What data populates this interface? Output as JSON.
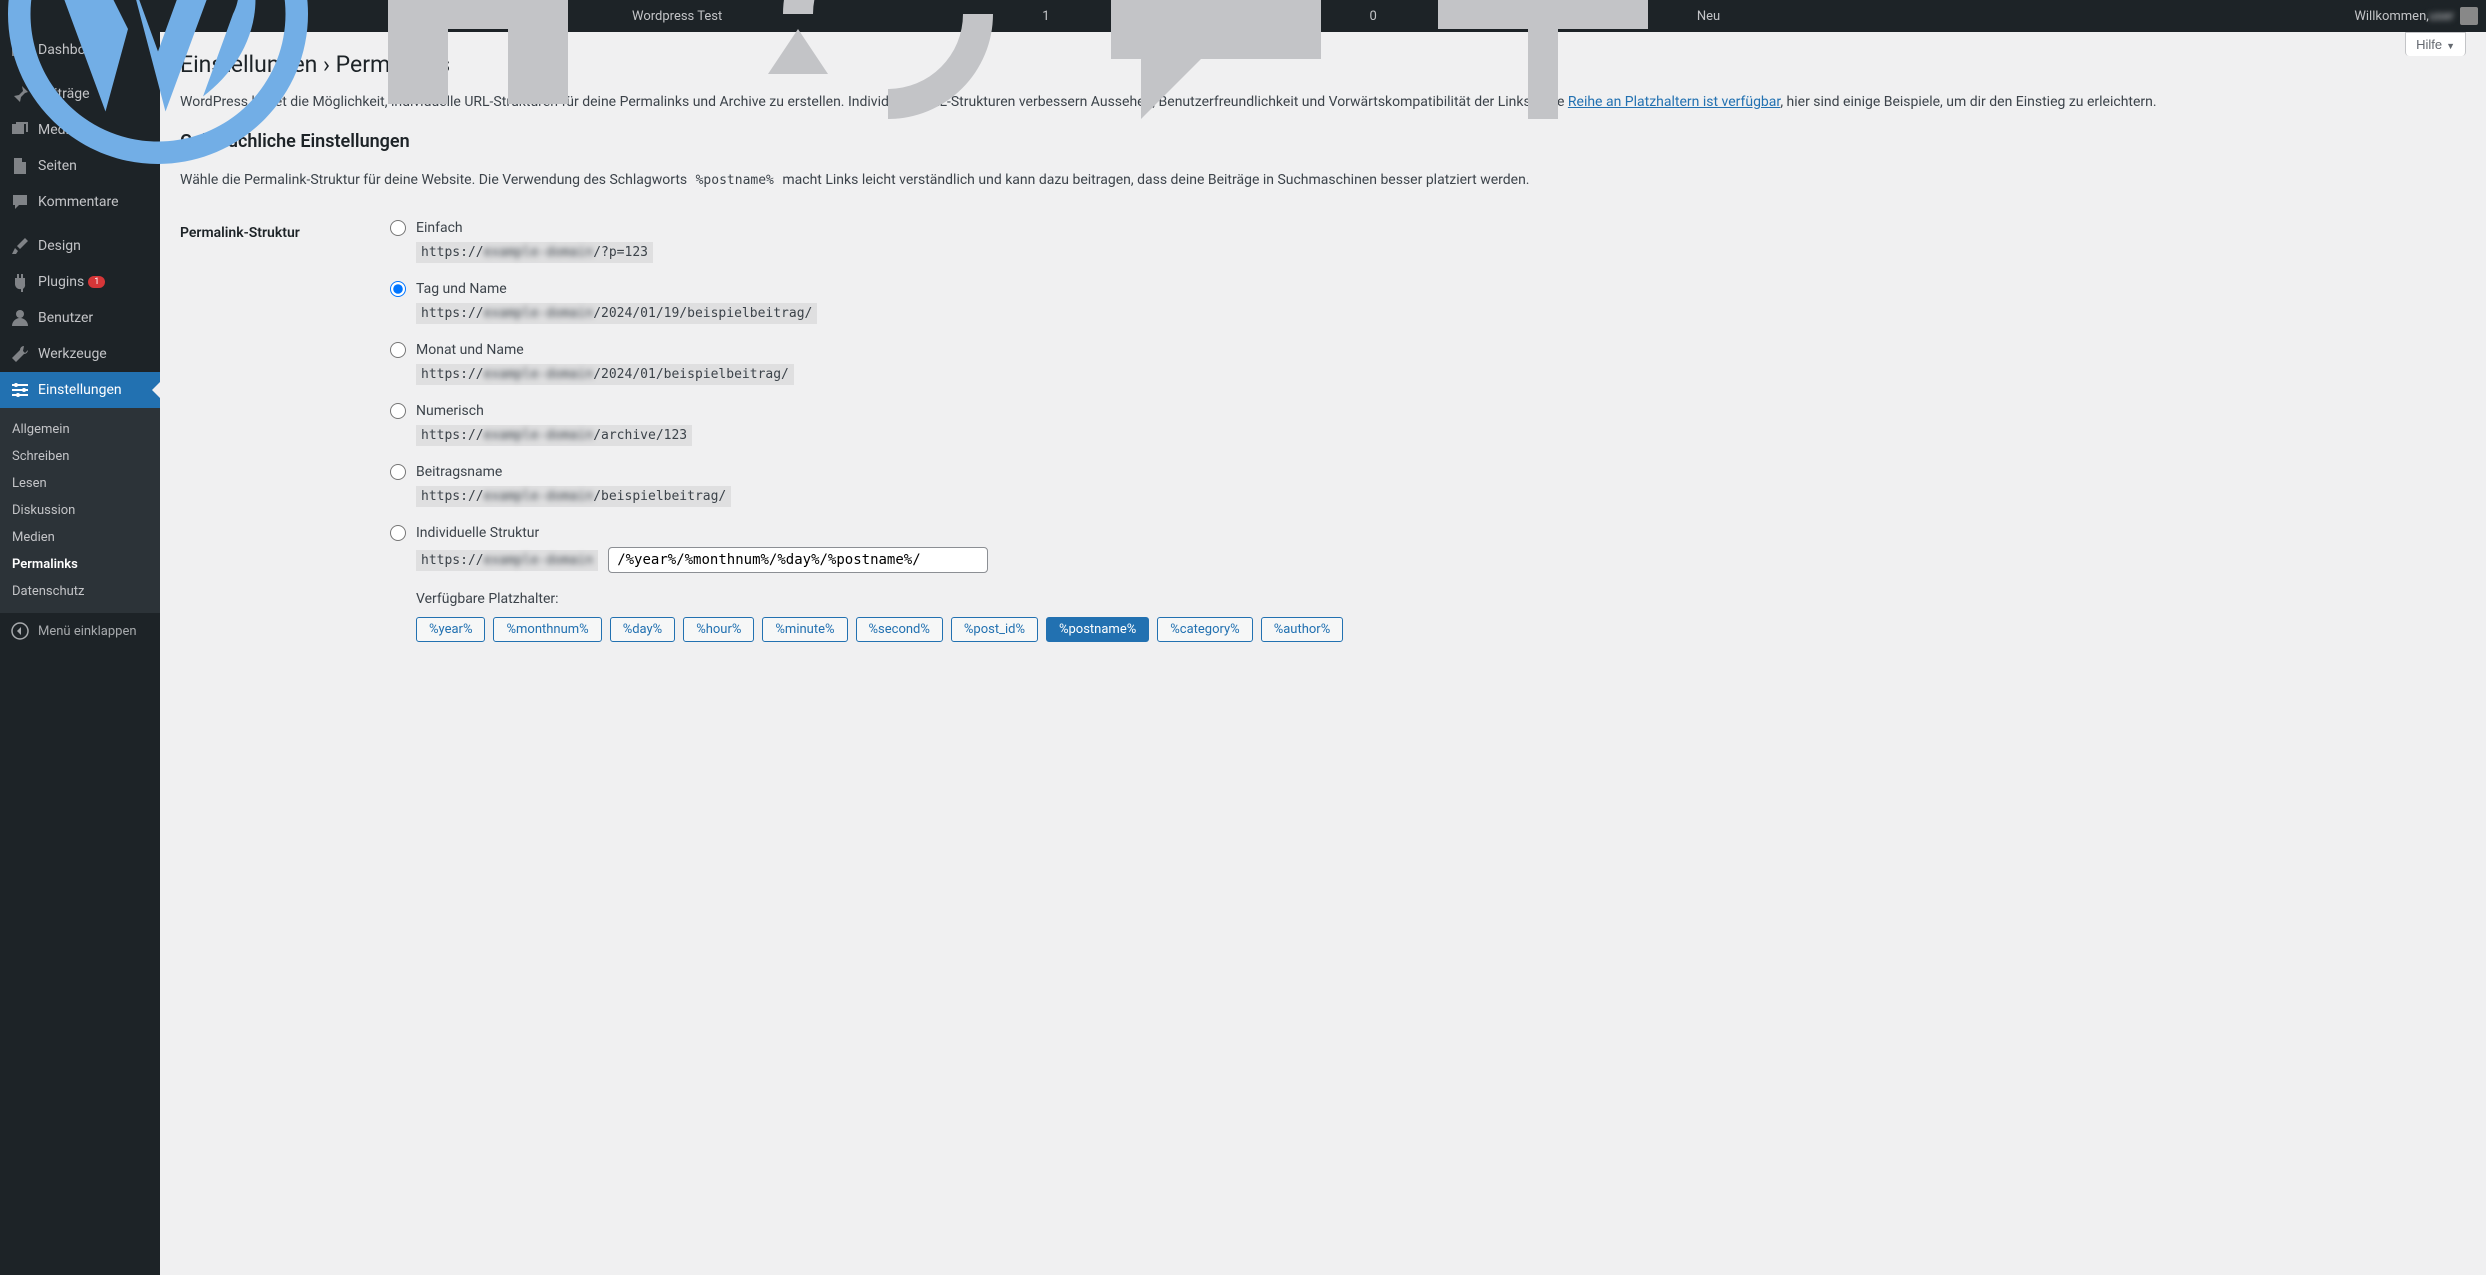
{
  "adminbar": {
    "site_name": "Wordpress Test",
    "updates": "1",
    "comments": "0",
    "new": "Neu",
    "welcome": "Willkommen,"
  },
  "sidebar": {
    "dashboard": "Dashboard",
    "posts": "Beiträge",
    "media": "Medien",
    "pages": "Seiten",
    "comments": "Kommentare",
    "appearance": "Design",
    "plugins": "Plugins",
    "plugins_count": "1",
    "users": "Benutzer",
    "tools": "Werkzeuge",
    "settings": "Einstellungen",
    "submenu": {
      "general": "Allgemein",
      "writing": "Schreiben",
      "reading": "Lesen",
      "discussion": "Diskussion",
      "media": "Medien",
      "permalinks": "Permalinks",
      "privacy": "Datenschutz"
    },
    "collapse": "Menü einklappen"
  },
  "page": {
    "help": "Hilfe",
    "title": "Einstellungen › Permalinks",
    "intro_1": "WordPress bietet die Möglichkeit, individuelle URL-Strukturen für deine Permalinks und Archive zu erstellen. Individuelle URL-Strukturen verbessern Aussehen, Benutzerfreundlichkeit und Vorwärtskompatibilität der Links. Eine ",
    "intro_link": "Reihe an Platzhaltern ist verfügbar",
    "intro_2": ", hier sind einige Beispiele, um dir den Einstieg zu erleichtern.",
    "common_heading": "Gebräuchliche Einstellungen",
    "common_desc_1": "Wähle die Permalink-Struktur für deine Website. Die Verwendung des Schlagworts ",
    "postname_code": "%postname%",
    "common_desc_2": " macht Links leicht verständlich und kann dazu beitragen, dass deine Beiträge in Suchmaschinen besser platziert werden.",
    "structure_label": "Permalink-Struktur",
    "options": {
      "plain": {
        "label": "Einfach",
        "prefix": "https://",
        "blur": "example-domain",
        "suffix": "/?p=123"
      },
      "dayname": {
        "label": "Tag und Name",
        "prefix": "https://",
        "blur": "example-domain",
        "suffix": "/2024/01/19/beispielbeitrag/"
      },
      "monthname": {
        "label": "Monat und Name",
        "prefix": "https://",
        "blur": "example-domain",
        "suffix": "/2024/01/beispielbeitrag/"
      },
      "numeric": {
        "label": "Numerisch",
        "prefix": "https://",
        "blur": "example-domain",
        "suffix": "/archive/123"
      },
      "postname": {
        "label": "Beitragsname",
        "prefix": "https://",
        "blur": "example-domain",
        "suffix": "/beispielbeitrag/"
      },
      "custom": {
        "label": "Individuelle Struktur",
        "prefix": "https://",
        "blur": "example-domain",
        "value": "/%year%/%monthnum%/%day%/%postname%/"
      }
    },
    "tags_label": "Verfügbare Platzhalter:",
    "tags": [
      "%year%",
      "%monthnum%",
      "%day%",
      "%hour%",
      "%minute%",
      "%second%",
      "%post_id%",
      "%postname%",
      "%category%",
      "%author%"
    ]
  }
}
